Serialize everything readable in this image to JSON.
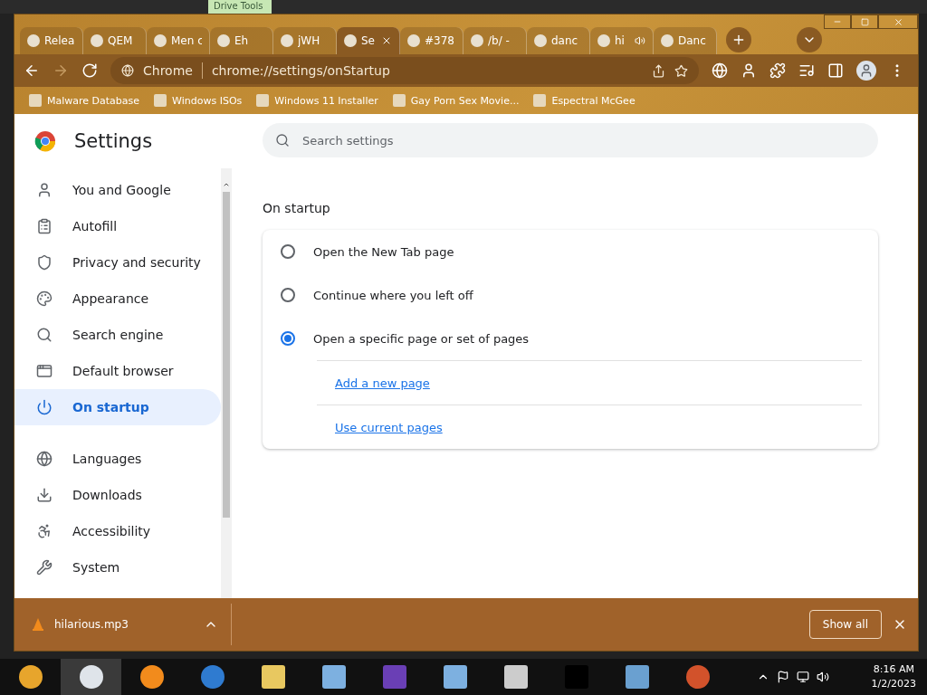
{
  "desktop": {
    "ribbon_tab": "Drive Tools"
  },
  "tabs": [
    {
      "label": "Relea",
      "selected": false,
      "audio": false
    },
    {
      "label": "QEM",
      "selected": false,
      "audio": false
    },
    {
      "label": "Men c",
      "selected": false,
      "audio": false
    },
    {
      "label": "Eh",
      "selected": false,
      "audio": false
    },
    {
      "label": "jWH",
      "selected": false,
      "audio": false
    },
    {
      "label": "Se",
      "selected": true,
      "audio": false
    },
    {
      "label": "#378",
      "selected": false,
      "audio": false
    },
    {
      "label": "/b/ -",
      "selected": false,
      "audio": false
    },
    {
      "label": "danc",
      "selected": false,
      "audio": false
    },
    {
      "label": "hi",
      "selected": false,
      "audio": true
    },
    {
      "label": "Danc",
      "selected": false,
      "audio": false
    }
  ],
  "address_bar": {
    "site": "Chrome",
    "url": "chrome://settings/onStartup"
  },
  "bookmarks": [
    "Malware Database",
    "Windows ISOs",
    "Windows 11 Installer",
    "Gay Porn Sex Movie...",
    "Espectral McGee"
  ],
  "settings": {
    "title": "Settings",
    "search": {
      "placeholder": "Search settings"
    },
    "sidebar": [
      {
        "label": "You and Google",
        "selected": false
      },
      {
        "label": "Autofill",
        "selected": false
      },
      {
        "label": "Privacy and security",
        "selected": false
      },
      {
        "label": "Appearance",
        "selected": false
      },
      {
        "label": "Search engine",
        "selected": false
      },
      {
        "label": "Default browser",
        "selected": false
      },
      {
        "label": "On startup",
        "selected": true
      },
      {
        "label": "Languages",
        "selected": false
      },
      {
        "label": "Downloads",
        "selected": false
      },
      {
        "label": "Accessibility",
        "selected": false
      },
      {
        "label": "System",
        "selected": false
      }
    ],
    "section_title": "On startup",
    "options": [
      {
        "label": "Open the New Tab page",
        "selected": false
      },
      {
        "label": "Continue where you left off",
        "selected": false
      },
      {
        "label": "Open a specific page or set of pages",
        "selected": true
      }
    ],
    "links": [
      "Add a new page",
      "Use current pages"
    ]
  },
  "download_bar": {
    "file": "hilarious.mp3",
    "show_all": "Show all"
  },
  "taskbar": {
    "time": "8:16 AM",
    "date": "1/2/2023"
  }
}
